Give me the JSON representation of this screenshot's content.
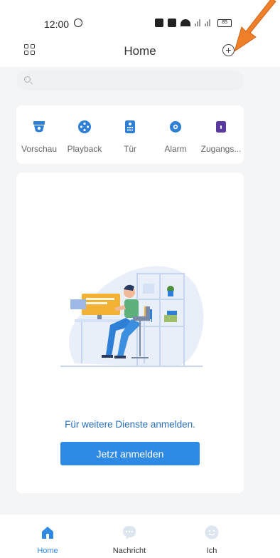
{
  "status_bar": {
    "time": "12:00",
    "battery": "85"
  },
  "header": {
    "title": "Home"
  },
  "search": {
    "placeholder": "",
    "value": ""
  },
  "quick_actions": [
    {
      "label": "Vorschau",
      "icon": "camera-icon"
    },
    {
      "label": "Playback",
      "icon": "playback-icon"
    },
    {
      "label": "Tür",
      "icon": "door-intercom-icon"
    },
    {
      "label": "Alarm",
      "icon": "alarm-icon"
    },
    {
      "label": "Zugangs...",
      "icon": "access-control-icon"
    }
  ],
  "main": {
    "message": "Für weitere Dienste anmelden.",
    "login_label": "Jetzt anmelden"
  },
  "tab_bar": {
    "items": [
      {
        "label": "Home",
        "icon": "home-icon",
        "active": true
      },
      {
        "label": "Nachricht",
        "icon": "message-icon",
        "active": false
      },
      {
        "label": "Ich",
        "icon": "profile-icon",
        "active": false
      }
    ]
  },
  "colors": {
    "accent": "#2f8ae5",
    "icon_blue": "#2e7fd6",
    "icon_purple": "#5b3aa0",
    "annotation_arrow": "#f07f2a"
  }
}
